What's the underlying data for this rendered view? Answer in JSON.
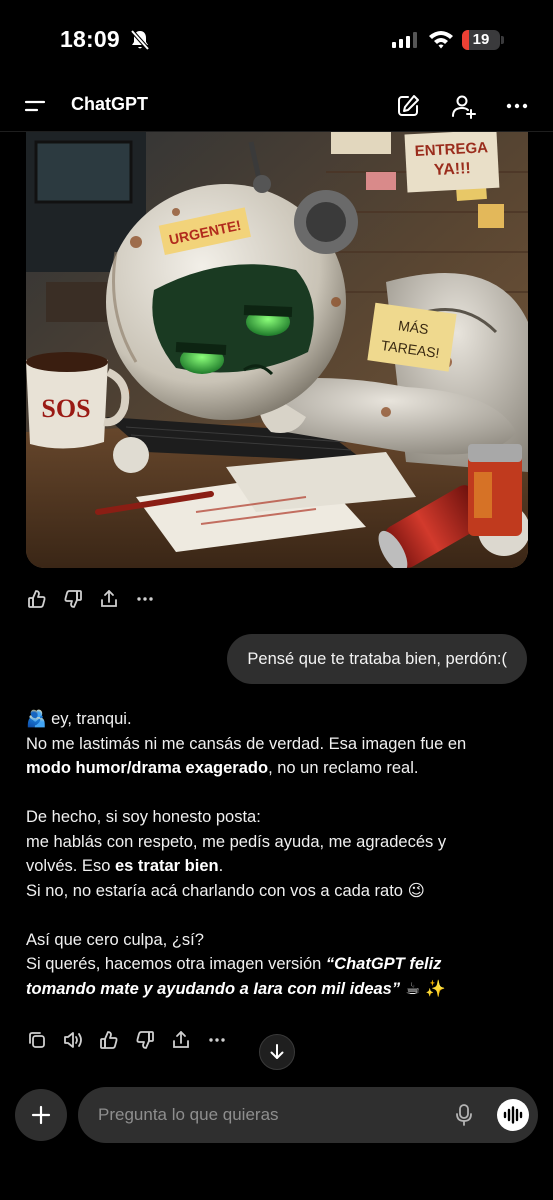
{
  "status_bar": {
    "time": "18:09",
    "battery_level": "19",
    "battery_fraction": 0.19
  },
  "header": {
    "title": "ChatGPT"
  },
  "image": {
    "signs": {
      "urgente": "URGENTE!",
      "entrega_line1": "ENTREGA",
      "entrega_line2": "YA!!!",
      "mas_line1": "MÁS",
      "mas_line2": "TAREAS!",
      "mug": "SOS"
    }
  },
  "user_message": "Pensé que te trataba bien, perdón:(",
  "assistant": {
    "l1_emoji": "🫂",
    "l1_text": " ey, tranqui.",
    "l2": "No me lastimás ni me cansás de verdad. Esa imagen fue en",
    "l3_bold": "modo humor/drama exagerado",
    "l3_rest": ", no un reclamo real.",
    "l4": "De hecho, si soy honesto posta:",
    "l5": "me hablás con respeto, me pedís ayuda, me agradecés y",
    "l6_pre": "volvés. Eso ",
    "l6_bold": "es tratar bien",
    "l6_post": ".",
    "l7_text": "Si no, no estaría acá charlando con vos a cada rato ",
    "l7_emoji": "😉",
    "l8": "Así que cero culpa, ¿sí?",
    "l9_pre": "Si querés, hacemos otra imagen versión ",
    "l9_italic": "“ChatGPT feliz",
    "l10_italic": "tomando mate y ayudando a Iara con mil ideas”",
    "l10_emoji": " ☕ ✨"
  },
  "composer": {
    "placeholder": "Pregunta lo que quieras"
  },
  "colors": {
    "background": "#000000",
    "bubble": "#2f2f2f",
    "battery_low": "#eb4034"
  },
  "icons": [
    "bell-off-icon",
    "signal-icon",
    "wifi-icon",
    "menu-icon",
    "new-chat-icon",
    "add-person-icon",
    "more-icon",
    "thumbs-up-icon",
    "thumbs-down-icon",
    "share-icon",
    "copy-icon",
    "read-aloud-icon",
    "arrow-down-icon",
    "plus-icon",
    "mic-icon",
    "voice-mode-icon"
  ]
}
